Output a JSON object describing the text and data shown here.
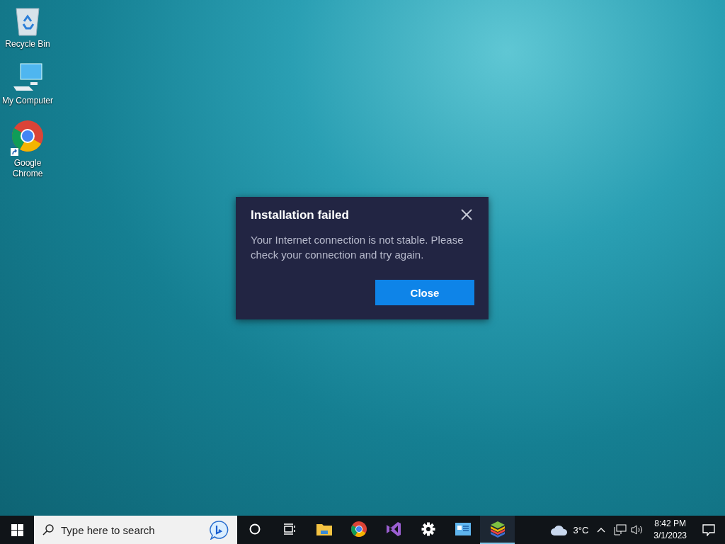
{
  "desktop_icons": [
    {
      "label": "Recycle Bin",
      "kind": "recycle"
    },
    {
      "label": "My Computer",
      "kind": "computer"
    },
    {
      "label": "Google Chrome",
      "kind": "chrome"
    }
  ],
  "dialog": {
    "title": "Installation failed",
    "message": "Your Internet connection is not stable. Please check your connection and try again.",
    "button": "Close"
  },
  "taskbar": {
    "search": {
      "placeholder": "Type here to search"
    },
    "apps": [
      {
        "kind": "cortana",
        "running": false
      },
      {
        "kind": "taskview",
        "running": false
      },
      {
        "kind": "explorer",
        "running": false
      },
      {
        "kind": "chrome",
        "running": false
      },
      {
        "kind": "visualstudio",
        "running": false
      },
      {
        "kind": "settings",
        "running": false
      },
      {
        "kind": "panel",
        "running": false
      },
      {
        "kind": "stack",
        "running": true
      }
    ],
    "weather": "3°C",
    "time": "8:42 PM",
    "date": "3/1/2023"
  }
}
